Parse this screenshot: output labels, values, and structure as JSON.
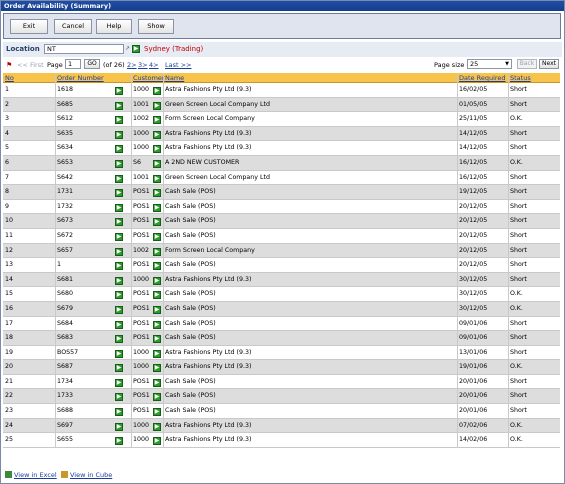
{
  "window": {
    "title": "Order Availability (Summary)"
  },
  "toolbar": {
    "exit": "Exit",
    "cancel": "Cancel",
    "help": "Help",
    "show": "Show"
  },
  "location": {
    "label": "Location",
    "value": "NT",
    "name": "Sydney (Trading)"
  },
  "pager": {
    "first": "<< First",
    "page_label": "Page",
    "page": "1",
    "go": "GO",
    "of": "(of 26)",
    "links": [
      "2>",
      "3>",
      "4>"
    ],
    "last": "Last >>",
    "size_label": "Page size",
    "size": "25",
    "back": "Back",
    "next": "Next"
  },
  "columns": {
    "no": "No",
    "order_number": "Order Number",
    "customer": "Customer",
    "name": "Name",
    "date_required": "Date Required",
    "status": "Status"
  },
  "rows": [
    {
      "no": "1",
      "order": "1618",
      "cust": "1000",
      "name": "Astra Fashions Pty Ltd (9.3)",
      "date": "16/02/05",
      "status": "Short"
    },
    {
      "no": "2",
      "order": "S685",
      "cust": "1001",
      "name": "Green Screen Local Company Ltd",
      "date": "01/05/05",
      "status": "Short"
    },
    {
      "no": "3",
      "order": "S612",
      "cust": "1002",
      "name": "Form Screen Local Company",
      "date": "25/11/05",
      "status": "O.K."
    },
    {
      "no": "4",
      "order": "S635",
      "cust": "1000",
      "name": "Astra Fashions Pty Ltd (9.3)",
      "date": "14/12/05",
      "status": "Short"
    },
    {
      "no": "5",
      "order": "S634",
      "cust": "1000",
      "name": "Astra Fashions Pty Ltd (9.3)",
      "date": "14/12/05",
      "status": "Short"
    },
    {
      "no": "6",
      "order": "S653",
      "cust": "S6",
      "name": "A 2ND NEW CUSTOMER",
      "date": "16/12/05",
      "status": "O.K."
    },
    {
      "no": "7",
      "order": "S642",
      "cust": "1001",
      "name": "Green Screen Local Company Ltd",
      "date": "16/12/05",
      "status": "Short"
    },
    {
      "no": "8",
      "order": "1731",
      "cust": "POS1",
      "name": "Cash Sale (POS)",
      "date": "19/12/05",
      "status": "Short"
    },
    {
      "no": "9",
      "order": "1732",
      "cust": "POS1",
      "name": "Cash Sale (POS)",
      "date": "20/12/05",
      "status": "Short"
    },
    {
      "no": "10",
      "order": "S673",
      "cust": "POS1",
      "name": "Cash Sale (POS)",
      "date": "20/12/05",
      "status": "Short"
    },
    {
      "no": "11",
      "order": "S672",
      "cust": "POS1",
      "name": "Cash Sale (POS)",
      "date": "20/12/05",
      "status": "Short"
    },
    {
      "no": "12",
      "order": "S657",
      "cust": "1002",
      "name": "Form Screen Local Company",
      "date": "20/12/05",
      "status": "Short"
    },
    {
      "no": "13",
      "order": "1",
      "cust": "POS1",
      "name": "Cash Sale (POS)",
      "date": "20/12/05",
      "status": "Short"
    },
    {
      "no": "14",
      "order": "S681",
      "cust": "1000",
      "name": "Astra Fashions Pty Ltd (9.3)",
      "date": "30/12/05",
      "status": "Short"
    },
    {
      "no": "15",
      "order": "S680",
      "cust": "POS1",
      "name": "Cash Sale (POS)",
      "date": "30/12/05",
      "status": "O.K."
    },
    {
      "no": "16",
      "order": "S679",
      "cust": "POS1",
      "name": "Cash Sale (POS)",
      "date": "30/12/05",
      "status": "O.K."
    },
    {
      "no": "17",
      "order": "S684",
      "cust": "POS1",
      "name": "Cash Sale (POS)",
      "date": "09/01/06",
      "status": "Short"
    },
    {
      "no": "18",
      "order": "S683",
      "cust": "POS1",
      "name": "Cash Sale (POS)",
      "date": "09/01/06",
      "status": "Short"
    },
    {
      "no": "19",
      "order": "BOS57",
      "cust": "1000",
      "name": "Astra Fashions Pty Ltd (9.3)",
      "date": "13/01/06",
      "status": "Short"
    },
    {
      "no": "20",
      "order": "S687",
      "cust": "1000",
      "name": "Astra Fashions Pty Ltd (9.3)",
      "date": "19/01/06",
      "status": "O.K."
    },
    {
      "no": "21",
      "order": "1734",
      "cust": "POS1",
      "name": "Cash Sale (POS)",
      "date": "20/01/06",
      "status": "Short"
    },
    {
      "no": "22",
      "order": "1733",
      "cust": "POS1",
      "name": "Cash Sale (POS)",
      "date": "20/01/06",
      "status": "Short"
    },
    {
      "no": "23",
      "order": "S688",
      "cust": "POS1",
      "name": "Cash Sale (POS)",
      "date": "20/01/06",
      "status": "Short"
    },
    {
      "no": "24",
      "order": "S697",
      "cust": "1000",
      "name": "Astra Fashions Pty Ltd (9.3)",
      "date": "07/02/06",
      "status": "O.K."
    },
    {
      "no": "25",
      "order": "S655",
      "cust": "1000",
      "name": "Astra Fashions Pty Ltd (9.3)",
      "date": "14/02/06",
      "status": "O.K."
    }
  ],
  "footer": {
    "excel": "View in Excel",
    "cube": "View in Cube"
  },
  "colors": {
    "title_bar": "#1f4ea6",
    "header_bg": "#f7c34a",
    "link": "#1a3d9c",
    "location_name": "#c00000",
    "go_icon": "#2e9a2e"
  }
}
